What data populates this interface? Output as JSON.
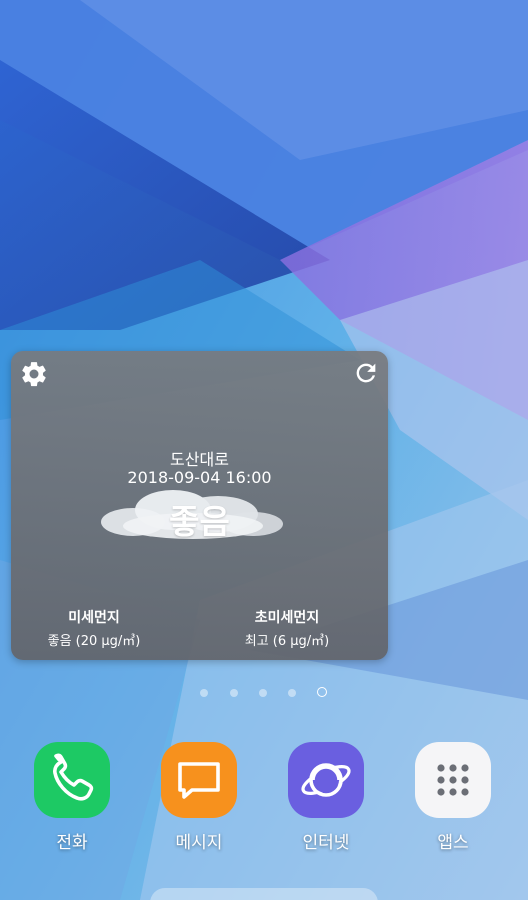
{
  "widget": {
    "location": "도산대로",
    "datetime": "2018-09-04 16:00",
    "status": "좋음",
    "pm10": {
      "title": "미세먼지",
      "value": "좋음 (20 μg/㎥)"
    },
    "pm25": {
      "title": "초미세먼지",
      "value": "최고 (6 μg/㎥)"
    }
  },
  "page_indicator": {
    "count": 5,
    "active_index": 4
  },
  "dock": [
    {
      "label": "전화",
      "icon": "phone-icon",
      "color": "#1dc964"
    },
    {
      "label": "메시지",
      "icon": "message-icon",
      "color": "#f7911d"
    },
    {
      "label": "인터넷",
      "icon": "planet-icon",
      "color": "#6a5fe0"
    },
    {
      "label": "앱스",
      "icon": "apps-grid-icon",
      "color": "#f5f5f7"
    }
  ],
  "colors": {
    "wallpaper_blue": "#2f6fd6",
    "wallpaper_purple": "#7a63cf",
    "widget_bg": "#6f7177"
  }
}
